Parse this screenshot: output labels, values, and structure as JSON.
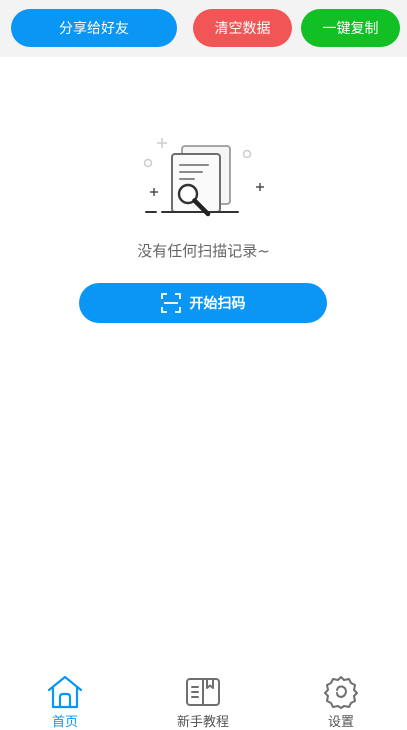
{
  "toolbar": {
    "share_label": "分享给好友",
    "clear_label": "清空数据",
    "copy_label": "一键复制"
  },
  "empty_state": {
    "message": "没有任何扫描记录~",
    "scan_button_label": "开始扫码"
  },
  "bottom_nav": {
    "items": [
      {
        "label": "首页",
        "icon": "home-icon",
        "active": true
      },
      {
        "label": "新手教程",
        "icon": "book-icon",
        "active": false
      },
      {
        "label": "设置",
        "icon": "settings-gear-icon",
        "active": false
      }
    ]
  },
  "colors": {
    "primary": "#0a96f5",
    "danger": "#f25555",
    "success": "#12bf24",
    "toolbar_bg": "#f3f3f3",
    "muted_text": "#666666"
  }
}
